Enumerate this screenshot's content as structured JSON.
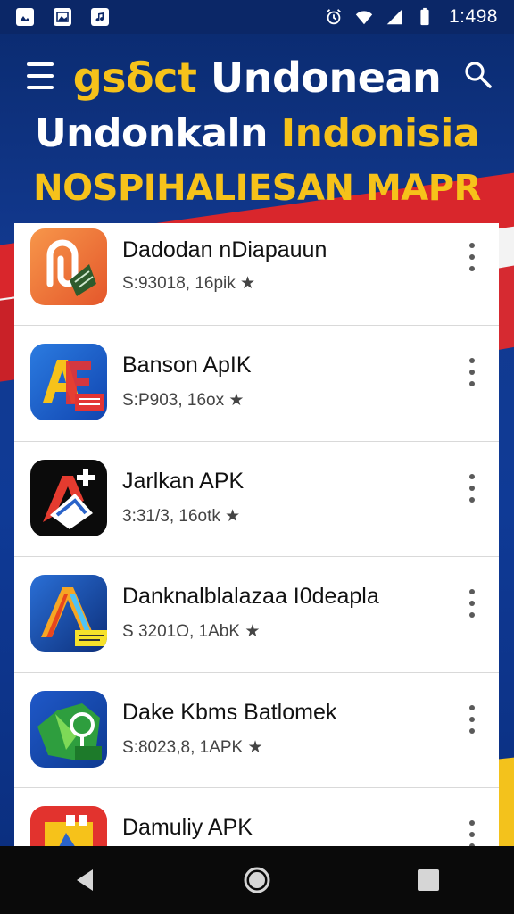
{
  "status_bar": {
    "time": "1:498",
    "left_icons": [
      "image-icon",
      "image-icon",
      "music-icon"
    ],
    "right_icons": [
      "alarm-icon",
      "wifi-icon",
      "signal-icon",
      "battery-icon"
    ]
  },
  "header": {
    "line1_part1": "gsδct",
    "line1_part2": "Undonean",
    "line2_part1": "Undonkaln",
    "line2_part2": "Indonisia",
    "line3": "NOSPIHALIESAN MAPR",
    "menu_icon": "hamburger-menu-icon",
    "search_icon": "search-icon"
  },
  "apps": [
    {
      "name": "Dadodan nDiapauun",
      "meta": "S:93018, 16pik ★",
      "icon": "orange-clip-app-icon"
    },
    {
      "name": "Banson ApIK",
      "meta": "S:P903, 16ox ★",
      "icon": "blue-ae-app-icon"
    },
    {
      "name": "Jarlkan APK",
      "meta": "3:31/3, 16otk ★",
      "icon": "black-a-plus-app-icon"
    },
    {
      "name": "Danknalblalazaa I0deapla",
      "meta": "S 3201O, 1AbK ★",
      "icon": "blue-a-stripe-app-icon"
    },
    {
      "name": "Dake Kbms Batlomek",
      "meta": "S:8023,8, 1APK ★",
      "icon": "green-map-app-icon"
    },
    {
      "name": "Damuliy APK",
      "meta": "",
      "icon": "red-app-icon"
    }
  ],
  "colors": {
    "banner_blue": "#12398f",
    "title_yellow": "#f6c21a",
    "flag_red": "#d9262c"
  },
  "nav": [
    "back-icon",
    "home-icon",
    "recents-icon"
  ]
}
